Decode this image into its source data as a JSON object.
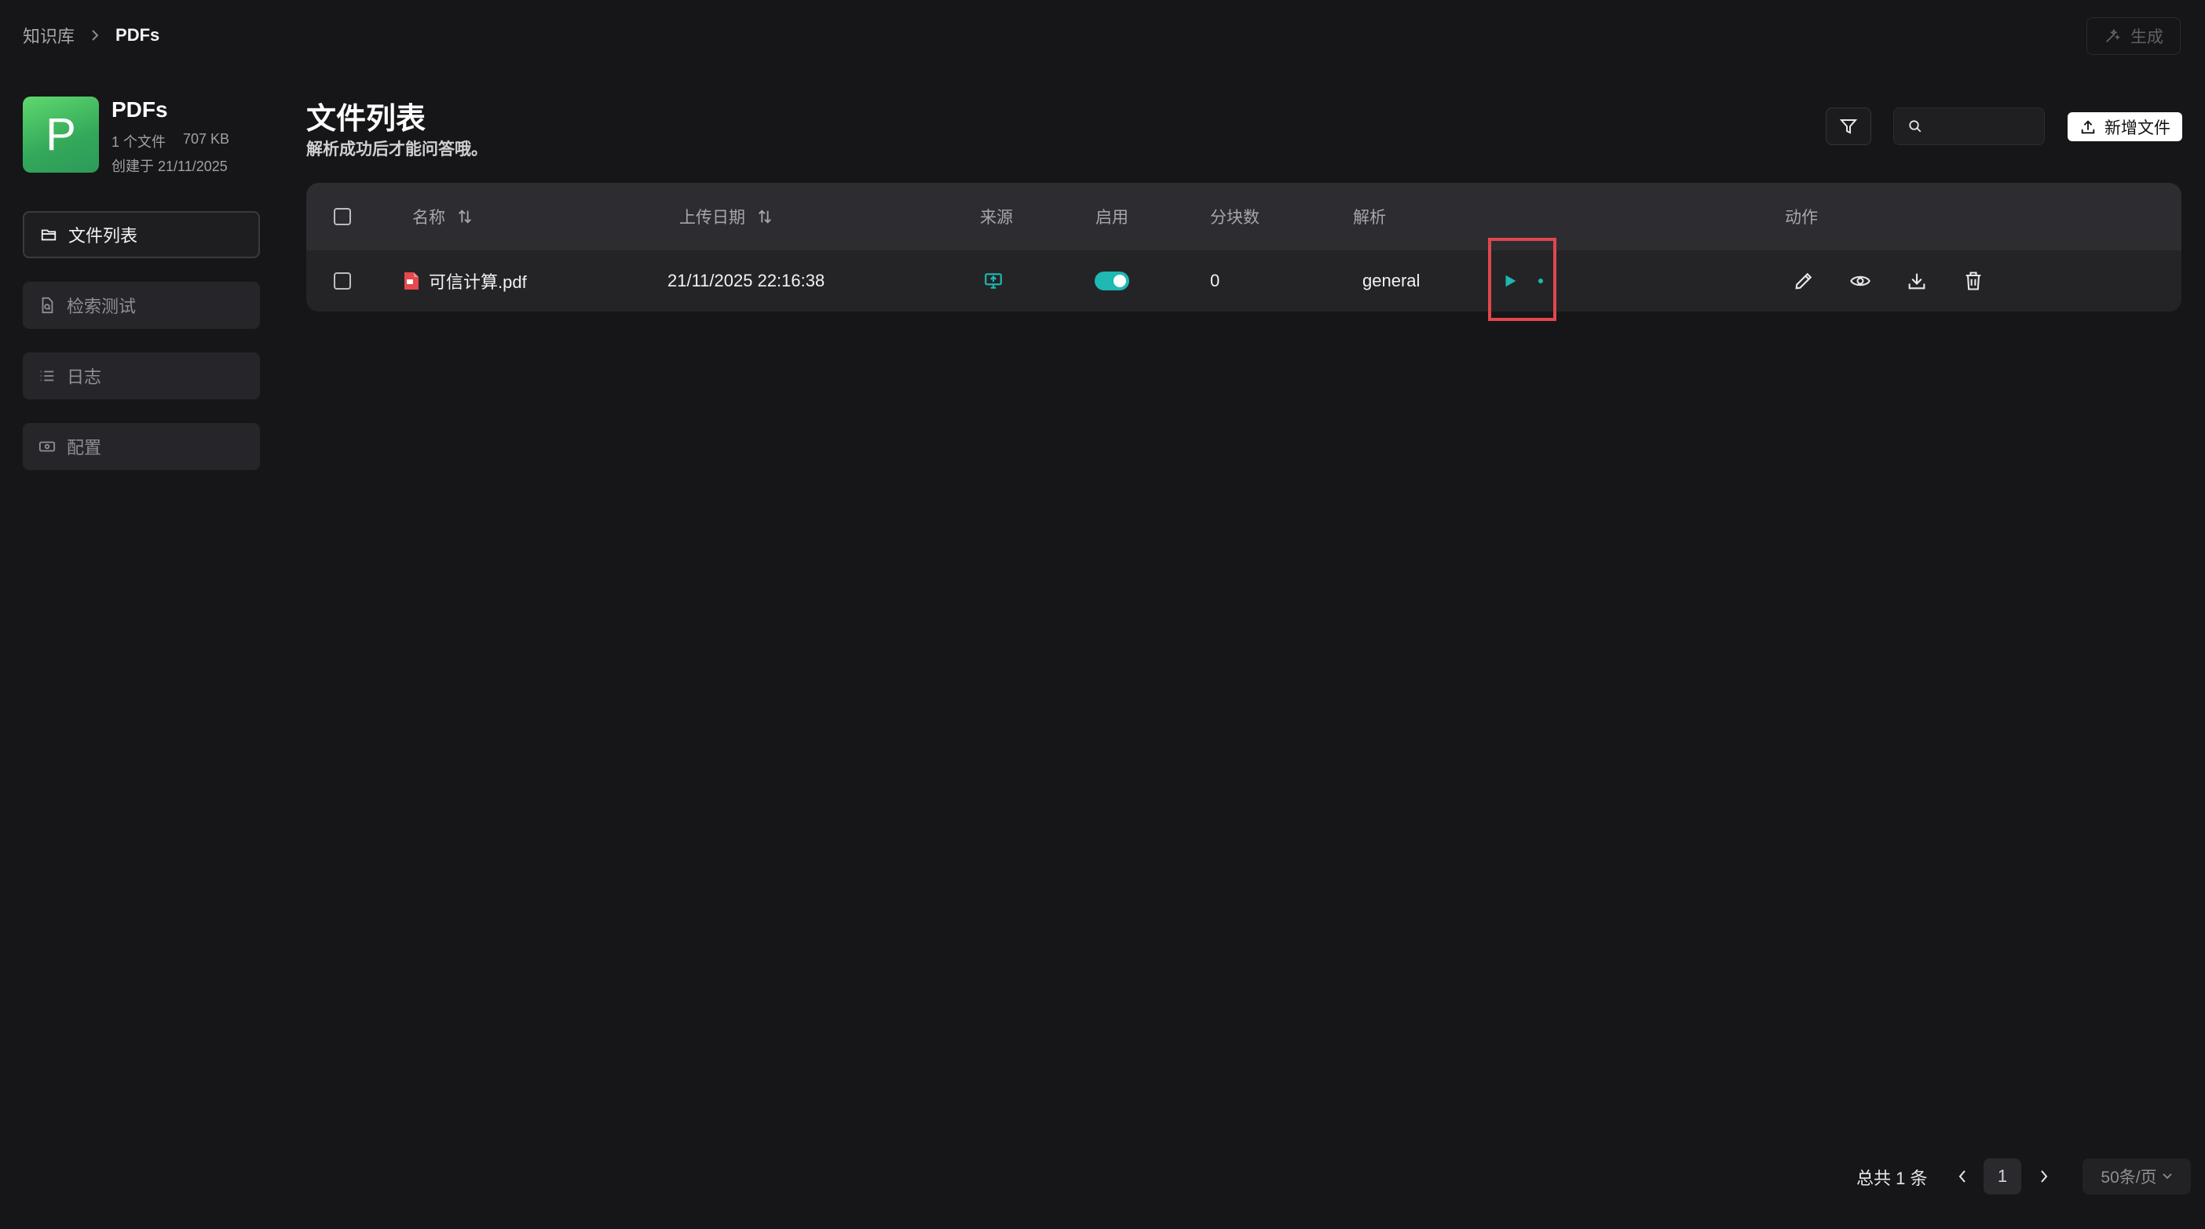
{
  "breadcrumb": {
    "root": "知识库",
    "current": "PDFs"
  },
  "header": {
    "generate_label": "生成"
  },
  "kb": {
    "avatar_letter": "P",
    "name": "PDFs",
    "file_count": "1 个文件",
    "size": "707 KB",
    "created": "创建于 21/11/2025",
    "avatar_color": "#3fbf63"
  },
  "sidebar": {
    "items": [
      {
        "label": "文件列表",
        "icon": "folder-icon",
        "active": true
      },
      {
        "label": "检索测试",
        "icon": "file-search-icon",
        "active": false
      },
      {
        "label": "日志",
        "icon": "list-icon",
        "active": false
      },
      {
        "label": "配置",
        "icon": "settings-box-icon",
        "active": false
      }
    ]
  },
  "main": {
    "title": "文件列表",
    "subtitle": "解析成功后才能问答哦。",
    "search": {
      "value": "",
      "placeholder": ""
    },
    "add_file_label": "新增文件"
  },
  "table": {
    "columns": {
      "name": "名称",
      "upload_date": "上传日期",
      "source": "来源",
      "enabled": "启用",
      "chunks": "分块数",
      "parse": "解析",
      "actions": "动作"
    },
    "rows": [
      {
        "name": "可信计算.pdf",
        "upload_date": "21/11/2025 22:16:38",
        "source_icon": "local-upload-icon",
        "enabled": true,
        "chunks": "0",
        "parser": "general",
        "actions": [
          "edit-icon",
          "eye-icon",
          "download-icon",
          "trash-icon"
        ]
      }
    ]
  },
  "pagination": {
    "total": "总共 1 条",
    "current_page": "1",
    "page_size": "50条/页"
  },
  "colors": {
    "background": "#161618",
    "accent": "#1fb8b2",
    "highlight": "#e0474c",
    "pdf_red": "#e5484d"
  }
}
